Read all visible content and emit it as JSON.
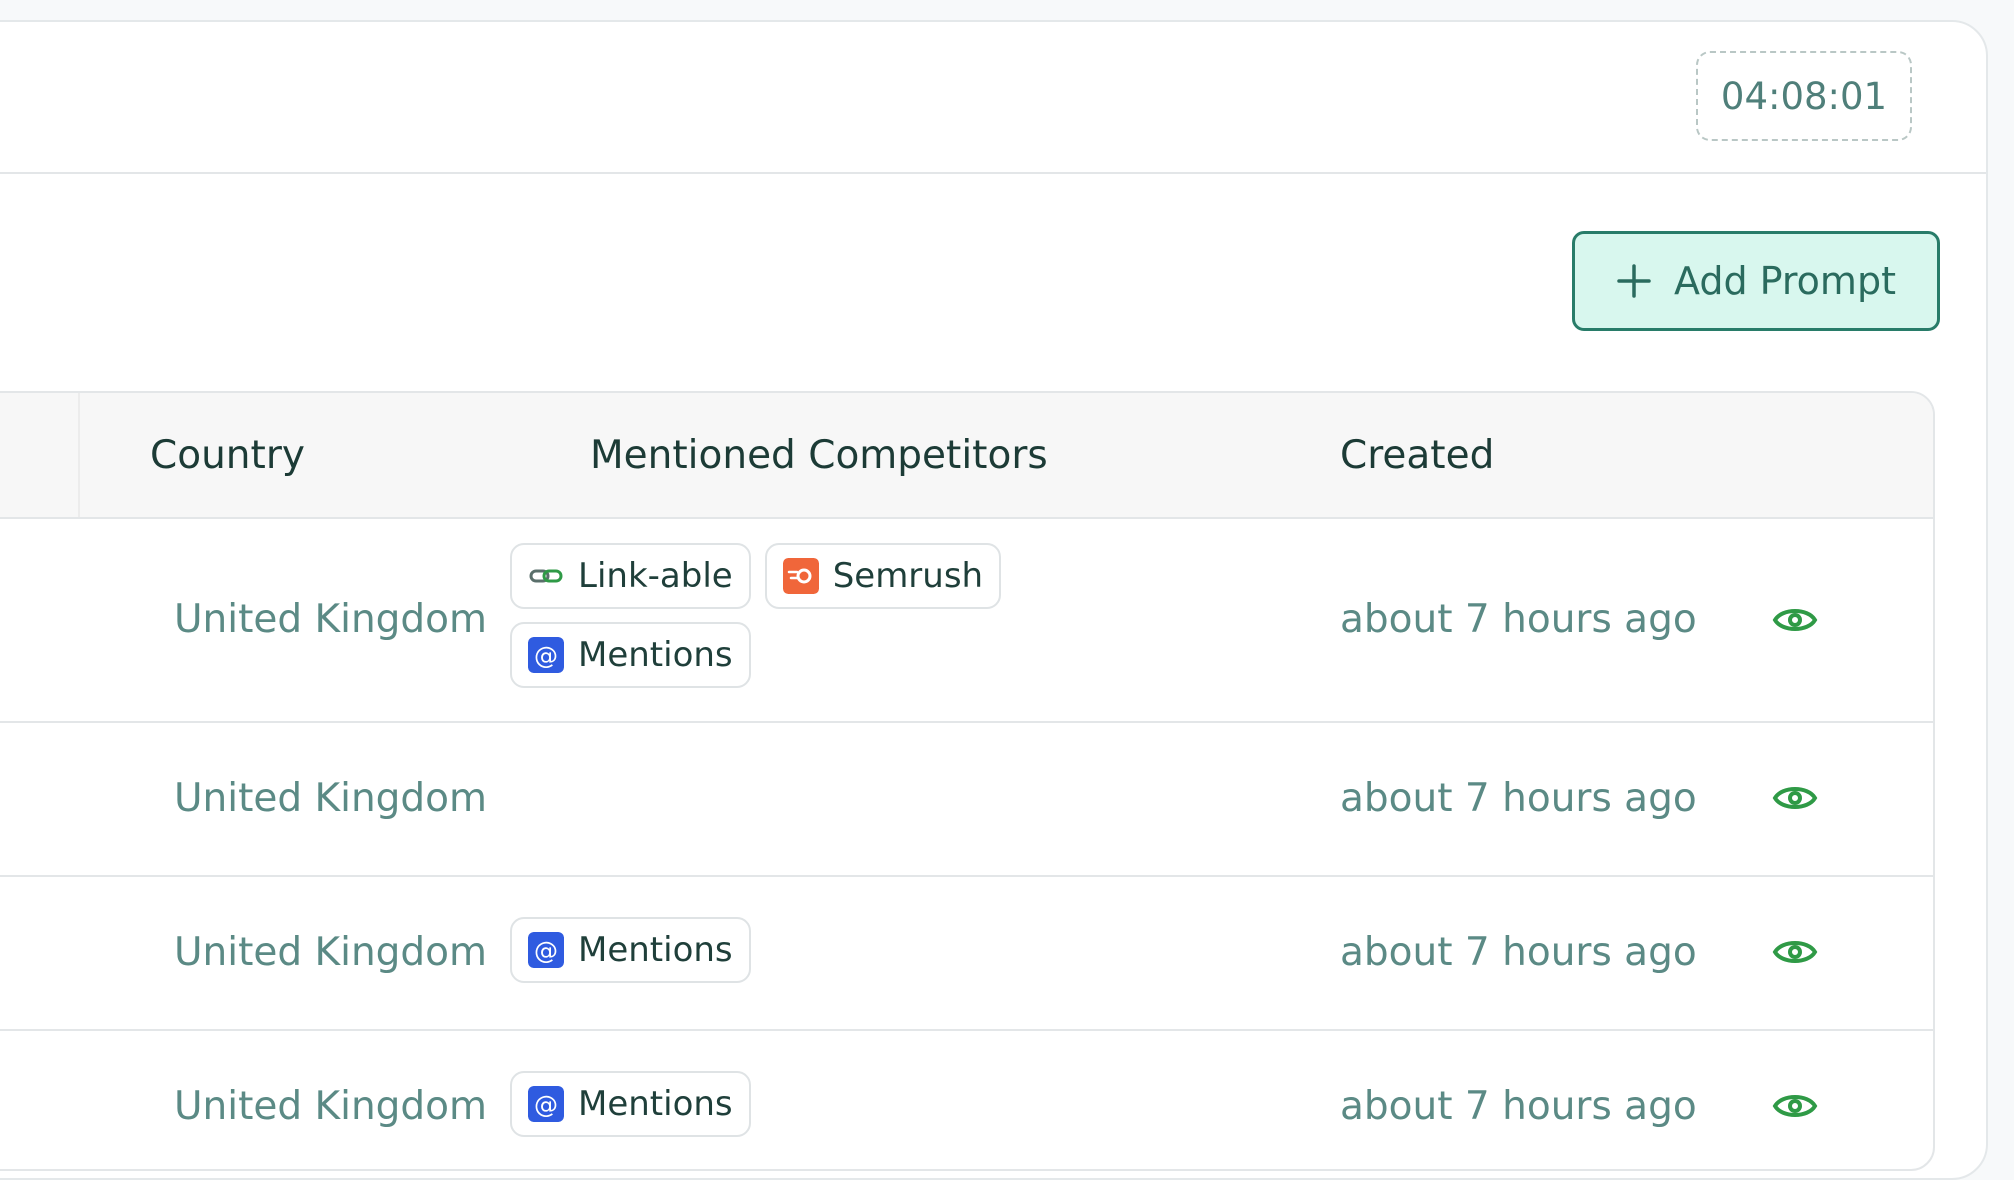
{
  "header": {
    "timer": "04:08:01"
  },
  "toolbar": {
    "add_prompt_label": "Add Prompt"
  },
  "table": {
    "columns": {
      "country": "Country",
      "competitors": "Mentioned Competitors",
      "created": "Created"
    },
    "rows": [
      {
        "country": "United Kingdom",
        "created": "about 7 hours ago",
        "competitors": [
          {
            "name": "Link-able",
            "icon": "link-icon"
          },
          {
            "name": "Semrush",
            "icon": "semrush-logo-icon"
          },
          {
            "name": "Mentions",
            "icon": "at-sign-icon"
          }
        ]
      },
      {
        "country": "United Kingdom",
        "created": "about 7 hours ago",
        "competitors": []
      },
      {
        "country": "United Kingdom",
        "created": "about 7 hours ago",
        "competitors": [
          {
            "name": "Mentions",
            "icon": "at-sign-icon"
          }
        ]
      },
      {
        "country": "United Kingdom",
        "created": "about 7 hours ago",
        "competitors": [
          {
            "name": "Mentions",
            "icon": "at-sign-icon"
          }
        ]
      }
    ]
  },
  "colors": {
    "accent": "#287c69",
    "accent_bg": "#d8f7ee",
    "muted_text": "#5b8a85",
    "eye": "#2f9a46",
    "semrush": "#f0663a",
    "mentions": "#2f5be0"
  }
}
